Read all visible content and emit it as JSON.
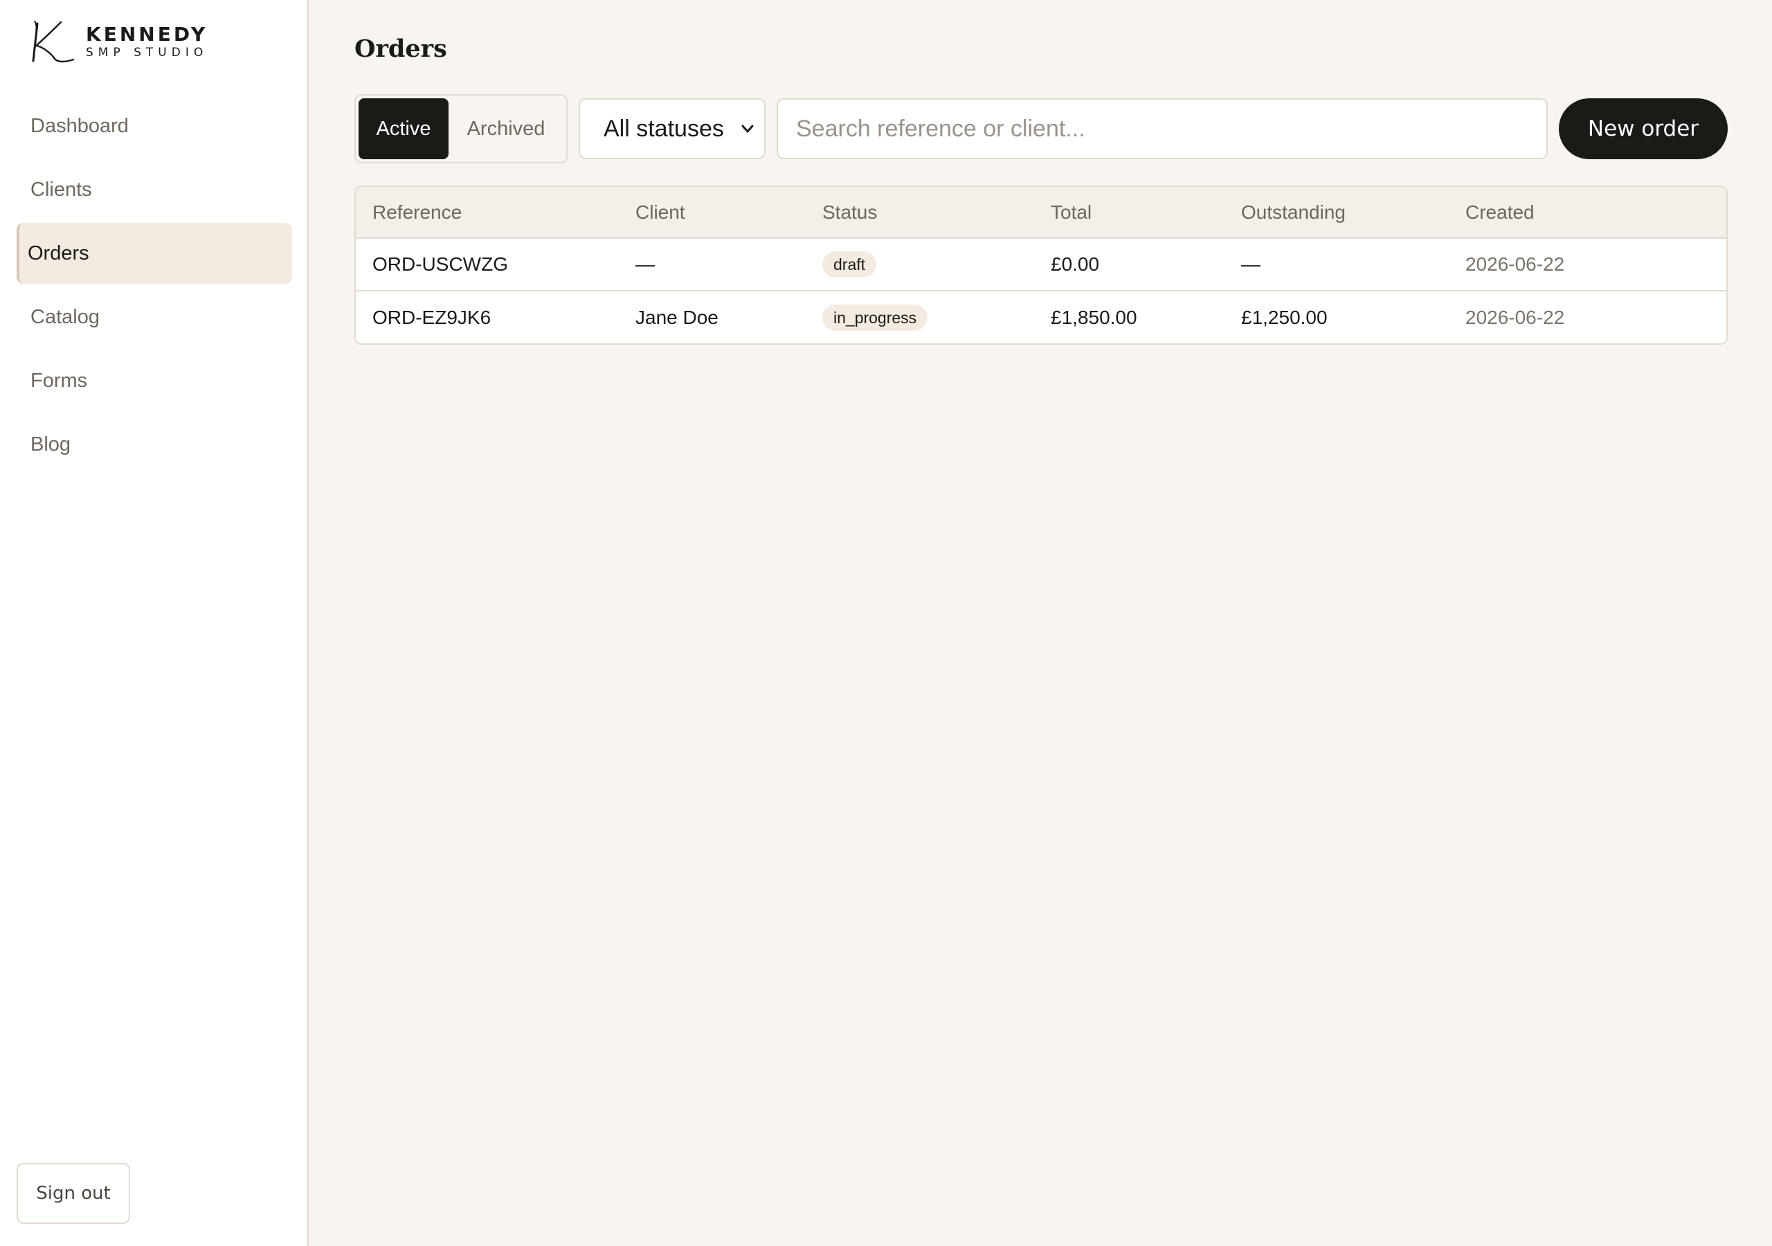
{
  "brand": {
    "name": "KENNEDY",
    "tagline": "SMP STUDIO"
  },
  "sidebar": {
    "items": [
      {
        "label": "Dashboard",
        "active": false
      },
      {
        "label": "Clients",
        "active": false
      },
      {
        "label": "Orders",
        "active": true
      },
      {
        "label": "Catalog",
        "active": false
      },
      {
        "label": "Forms",
        "active": false
      },
      {
        "label": "Blog",
        "active": false
      }
    ],
    "signout_label": "Sign out"
  },
  "page": {
    "title": "Orders"
  },
  "toolbar": {
    "tabs": [
      {
        "label": "Active",
        "selected": true
      },
      {
        "label": "Archived",
        "selected": false
      }
    ],
    "status_filter": "All statuses",
    "search_placeholder": "Search reference or client...",
    "new_order_label": "New order"
  },
  "table": {
    "columns": [
      "Reference",
      "Client",
      "Status",
      "Total",
      "Outstanding",
      "Created"
    ],
    "rows": [
      {
        "reference": "ORD-USCWZG",
        "client": "—",
        "status": "draft",
        "total": "£0.00",
        "outstanding": "—",
        "created": "2026-06-22"
      },
      {
        "reference": "ORD-EZ9JK6",
        "client": "Jane Doe",
        "status": "in_progress",
        "total": "£1,850.00",
        "outstanding": "£1,250.00",
        "created": "2026-06-22"
      }
    ]
  },
  "colors": {
    "background": "#f8f5f0",
    "sidebar": "#ffffff",
    "accent_dark": "#1c1a17",
    "active_nav": "#f3ebe1",
    "border": "#e2dbd1"
  },
  "icons": {
    "logo": "k-monogram-icon",
    "select_chevron": "chevron-down-icon"
  }
}
